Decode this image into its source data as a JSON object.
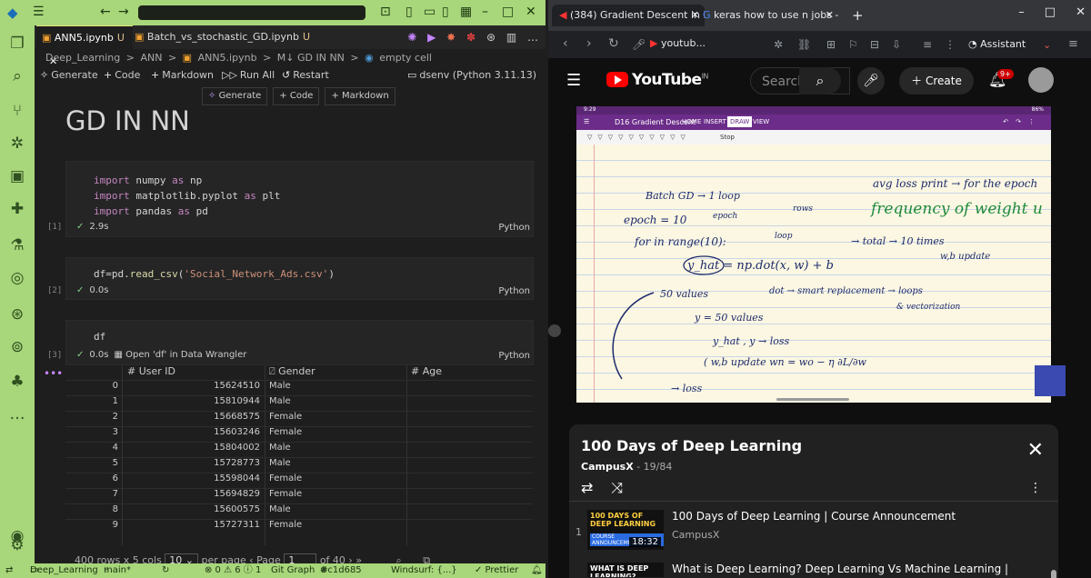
{
  "vscode": {
    "tabs": [
      {
        "label": "ANN5.ipynb",
        "flag": "U"
      },
      {
        "label": "Batch_vs_stochastic_GD.ipynb",
        "flag": "U"
      }
    ],
    "breadcrumb": [
      "Deep_Learning",
      ">",
      "ANN",
      ">",
      "ANN5.ipynb",
      ">",
      "M↓ GD IN NN",
      ">",
      "empty cell"
    ],
    "toolbar": {
      "generate": "Generate",
      "code": "Code",
      "markdown": "Markdown",
      "run_all": "Run All",
      "restart": "Restart",
      "kernel": "dsenv (Python 3.11.13)"
    },
    "cell_toolbar": {
      "generate": "Generate",
      "code": "+ Code",
      "markdown": "+ Markdown"
    },
    "markdown_title": "GD IN NN",
    "cells": [
      {
        "exec": "[1]",
        "status": "2.9s",
        "lang": "Python"
      },
      {
        "exec": "[2]",
        "status": "0.0s",
        "lang": "Python"
      },
      {
        "exec": "[3]",
        "status": "0.0s",
        "extra": "Open 'df' in Data Wrangler",
        "lang": "Python"
      }
    ],
    "code1": {
      "l1a": "import",
      "l1b": " numpy ",
      "l1c": "as",
      "l1d": " np",
      "l2a": "import",
      "l2b": " matplotlib.pyplot ",
      "l2c": "as",
      "l2d": " plt",
      "l3a": "import",
      "l3b": " pandas ",
      "l3c": "as",
      "l3d": " pd"
    },
    "code2": {
      "a": "df=pd.",
      "b": "read_csv",
      "c": "(",
      "d": "'Social_Network_Ads.csv'",
      "e": ")"
    },
    "code3": "df",
    "dataframe": {
      "columns": [
        "# User ID",
        "Gender",
        "# Age"
      ],
      "rows": [
        [
          "0",
          "15624510",
          "Male"
        ],
        [
          "1",
          "15810944",
          "Male"
        ],
        [
          "2",
          "15668575",
          "Female"
        ],
        [
          "3",
          "15603246",
          "Female"
        ],
        [
          "4",
          "15804002",
          "Male"
        ],
        [
          "5",
          "15728773",
          "Male"
        ],
        [
          "6",
          "15598044",
          "Female"
        ],
        [
          "7",
          "15694829",
          "Female"
        ],
        [
          "8",
          "15600575",
          "Male"
        ],
        [
          "9",
          "15727311",
          "Female"
        ]
      ]
    },
    "pager": {
      "summary": "400 rows x 5 cols",
      "per_page_value": "10",
      "per_page_label": "per page",
      "page_label": "Page",
      "page_value": "1",
      "of": "of 40"
    },
    "statusbar": {
      "folder": "Deep_Learning",
      "branch": "main*",
      "sync": "⊗ 0 ⚠ 6 ⓘ 1",
      "git_graph": "Git Graph",
      "commit": "#c1d685",
      "windsurf": "Windsurf: {...}",
      "prettier": "✓ Prettier"
    }
  },
  "browser": {
    "tabs": [
      {
        "label": "(384) Gradient Descent in Ne"
      },
      {
        "label": "keras how to use n jobs - Goo"
      }
    ],
    "url": "youtub...",
    "assistant": "Assistant",
    "youtube": {
      "logo": "YouTube",
      "logo_region": "IN",
      "search_placeholder": "Search",
      "create": "Create",
      "notif_badge": "9+"
    },
    "video": {
      "status_time": "9:29",
      "status_batt": "86%",
      "app_title": "D16 Gradient Descent",
      "menu_items": [
        "HOME",
        "INSERT",
        "DRAW",
        "VIEW"
      ],
      "stop": "Stop",
      "notes": [
        "avg loss print → for the epoch",
        "Batch GD → 1 loop",
        "frequency of weight u",
        "epoch = 10",
        "epoch",
        "rows",
        "for in range(10):",
        "loop",
        "→ total → 10 times",
        "w,b update",
        "y_hat = np.dot(x, w) + b",
        "50 values",
        "dot → smart replacement → loops",
        "& vectorization",
        "y = 50 values",
        "y_hat , y → loss",
        "( w,b update  wn = wo − η ∂L/∂w",
        "→ loss"
      ]
    },
    "playlist": {
      "title": "100 Days of Deep Learning",
      "channel": "CampusX",
      "position": "19/84",
      "items": [
        {
          "num": "1",
          "thumb_text": "100 DAYS OF DEEP LEARNING",
          "thumb_sub": "COURSE ANNOUNCEMENT",
          "duration": "18:32",
          "title": "100 Days of Deep Learning | Course Announcement",
          "channel": "CampusX"
        },
        {
          "num": "",
          "thumb_text": "WHAT IS DEEP LEARNING?",
          "thumb_sub": "",
          "duration": "",
          "title": "What is Deep Learning? Deep Learning Vs Machine Learning |",
          "channel": ""
        }
      ]
    }
  }
}
